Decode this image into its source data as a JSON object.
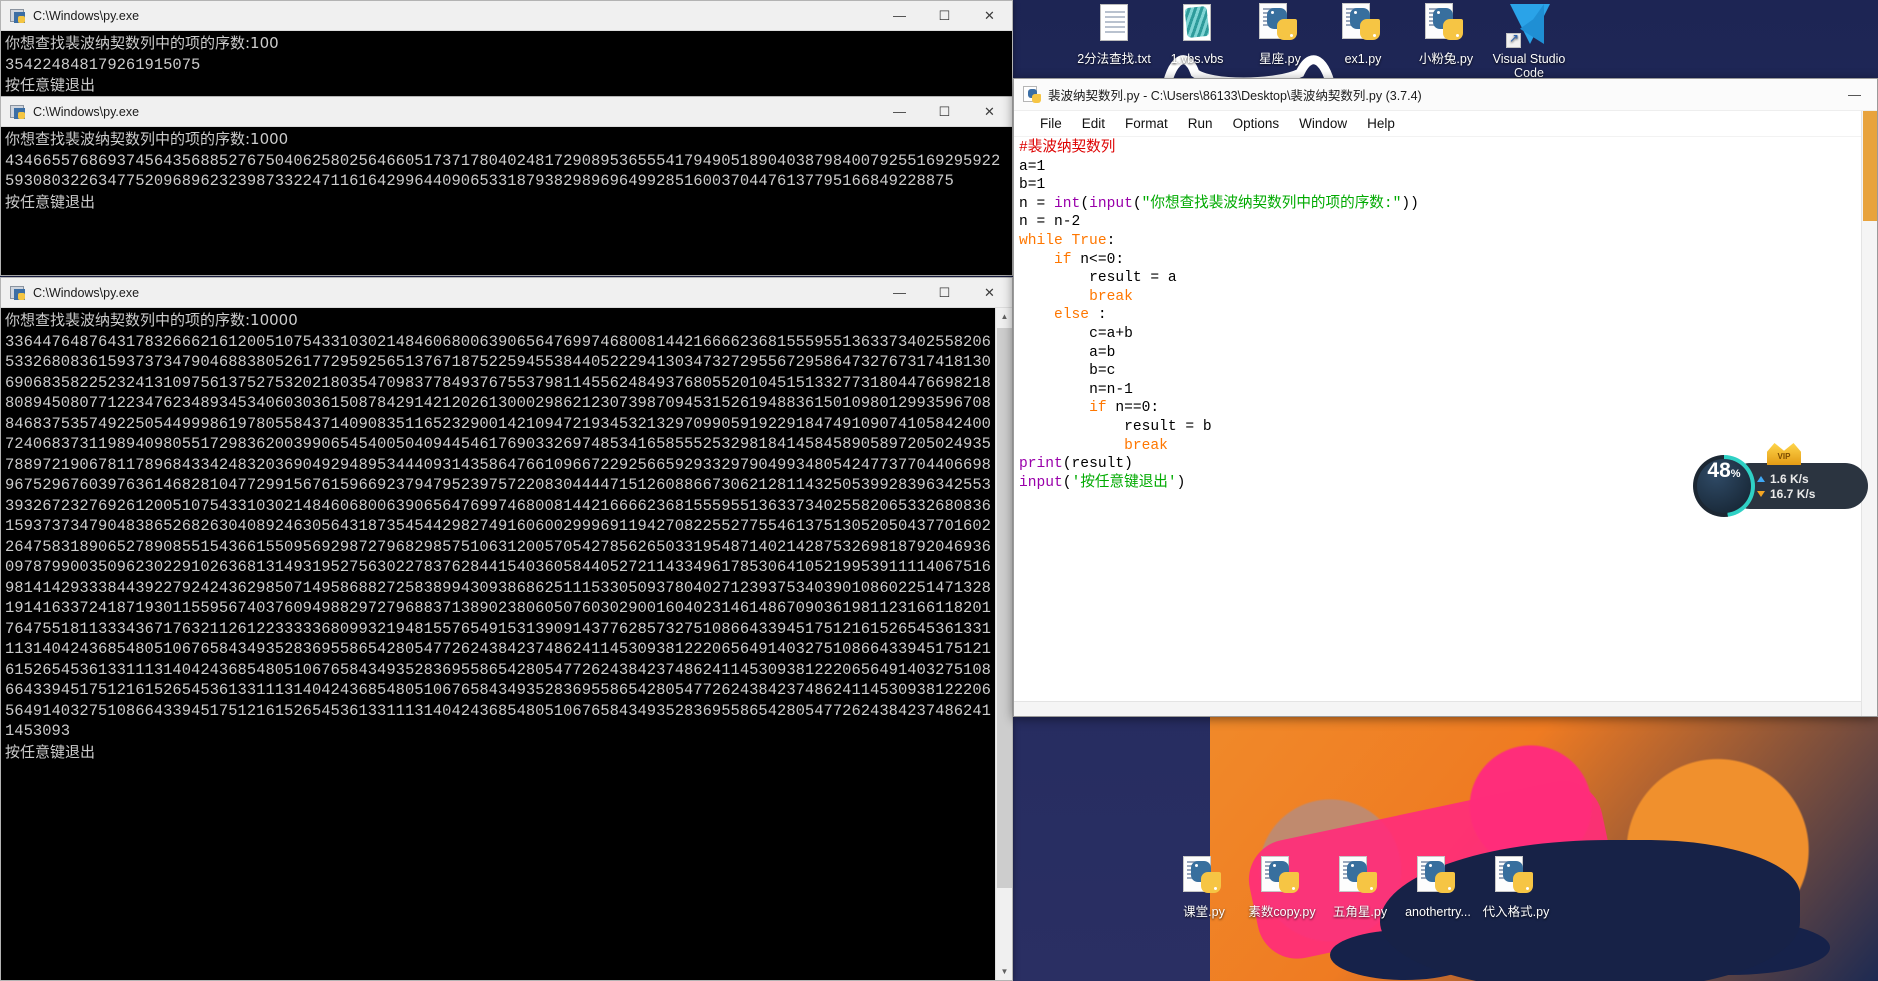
{
  "desktop": {
    "icons_top": [
      {
        "label": "2分法查找.txt",
        "type": "txt-icon",
        "icon_name": "text-file-icon"
      },
      {
        "label": "1.vbs.vbs",
        "type": "vbs-icon",
        "icon_name": "vbscript-file-icon"
      },
      {
        "label": "星座.py",
        "type": "py-icon",
        "icon_name": "python-file-icon"
      },
      {
        "label": "ex1.py",
        "type": "py-icon",
        "icon_name": "python-file-icon"
      },
      {
        "label": "小粉兔.py",
        "type": "py-icon",
        "icon_name": "python-file-icon"
      },
      {
        "label": "Visual Studio Code",
        "type": "vsc-icon",
        "icon_name": "visual-studio-code-icon"
      }
    ],
    "icons_bottom": [
      {
        "label": "课堂.py",
        "type": "py-icon",
        "icon_name": "python-file-icon"
      },
      {
        "label": "素数copy.py",
        "type": "py-icon",
        "icon_name": "python-file-icon"
      },
      {
        "label": "五角星.py",
        "type": "py-icon",
        "icon_name": "python-file-icon"
      },
      {
        "label": "anothertry...",
        "type": "py-icon",
        "icon_name": "python-file-icon"
      },
      {
        "label": "代入格式.py",
        "type": "py-icon",
        "icon_name": "python-file-icon"
      }
    ]
  },
  "consoles": [
    {
      "title": "C:\\Windows\\py.exe",
      "minimize": "—",
      "maximize": "☐",
      "close": "✕",
      "prompt": "你想查找裴波纳契数列中的项的序数:100",
      "result": "354224848179261915075",
      "exit_text": "按任意键退出"
    },
    {
      "title": "C:\\Windows\\py.exe",
      "minimize": "—",
      "maximize": "☐",
      "close": "✕",
      "prompt": "你想查找裴波纳契数列中的项的序数:1000",
      "result": "43466557686937456435688527675040625802564660517371780402481729089536555417949051890403879840079255169295922593080322634775209689623239873322471161642996440906533187938298969649928516003704476137795166849228875",
      "exit_text": "按任意键退出"
    },
    {
      "title": "C:\\Windows\\py.exe",
      "minimize": "—",
      "maximize": "☐",
      "close": "✕",
      "prompt": "你想查找裴波纳契数列中的项的序数:10000",
      "result": "33644764876431783266621612005107543310302148460680063906564769974680081442166662368155595513633734025582065332680836159373734790468838052617729592565137671875225945538440522294130347327295567295864732767317418130690683582252324131097561375275320218035470983778493767553798114556248493768055201045151332773180447669821880894508077122347623489345340603036150878429142120261300029862123073987094531526194883615010980129935967088468375357492250544999861978055843714090835116523290014210947219345321329709905919229184749109074105842400724068373119894098055172983620039906545400504094454617690332697485341658555253298184145845890589720502493578897219067811789684334248320369049294895344409314358647661096672292566592933297904993480542477377044066989675296760397636146828104772991567615966923794795239757220830444471512608866730621281143250539928396342553393267232769261200510754331030214846068006390656476997468008144216666236815559551363373402558206533268083615937373479048386526826304089246305643187354544298274916060029996911942708225527755461375130520504377016022647583189065278908551543661550956929872796829857510631200570542785626503319548714021428753269818792046936097879900350962302291026368131493195275630227837628441540360584405272114334961785306410521995391111406751698141429333844392279242436298507149586882725838994309386862511153305093780402712393753403901086022514713281914163372418719301155956740376094988297279688371389023806050760302900160402314614867090361981123166118201764755181133343671763211261223333368099321948155765491531390914377628573275108664339451751216152654536133111314042436854805106765843493528369558654280547726243842374862411453093812220656491403275108664339451751216152654536133111314042436854805106765843493528369558654280547726243842374862411453093812220656491403275108664339451751216152654536133111314042436854805106765843493528369558654280547726243842374862411453093812220656491403275108664339451751216152654536133111314042436854805106765843493528369558654280547726243842374862411453093",
      "exit_text": "按任意键退出"
    }
  ],
  "idle": {
    "title": "裴波纳契数列.py - C:\\Users\\86133\\Desktop\\裴波纳契数列.py (3.7.4)",
    "minimize": "—",
    "menu": [
      "File",
      "Edit",
      "Format",
      "Run",
      "Options",
      "Window",
      "Help"
    ],
    "code_lines": [
      {
        "indent": 0,
        "parts": [
          {
            "t": "#裴波纳契数列",
            "c": "cm"
          }
        ]
      },
      {
        "indent": 0,
        "parts": [
          {
            "t": "a=1",
            "c": ""
          }
        ]
      },
      {
        "indent": 0,
        "parts": [
          {
            "t": "b=1",
            "c": ""
          }
        ]
      },
      {
        "indent": 0,
        "parts": [
          {
            "t": "n = ",
            "c": ""
          },
          {
            "t": "int",
            "c": "bi"
          },
          {
            "t": "(",
            "c": ""
          },
          {
            "t": "input",
            "c": "bi"
          },
          {
            "t": "(",
            "c": ""
          },
          {
            "t": "\"你想查找裴波纳契数列中的项的序数:\"",
            "c": "st"
          },
          {
            "t": "))",
            "c": ""
          }
        ]
      },
      {
        "indent": 0,
        "parts": [
          {
            "t": "n = n-2",
            "c": ""
          }
        ]
      },
      {
        "indent": 0,
        "parts": [
          {
            "t": "while ",
            "c": "kw"
          },
          {
            "t": "True",
            "c": "kw"
          },
          {
            "t": ":",
            "c": ""
          }
        ]
      },
      {
        "indent": 1,
        "parts": [
          {
            "t": "if",
            "c": "kw"
          },
          {
            "t": " n<=0:",
            "c": ""
          }
        ]
      },
      {
        "indent": 2,
        "parts": [
          {
            "t": "result = a",
            "c": ""
          }
        ]
      },
      {
        "indent": 2,
        "parts": [
          {
            "t": "break",
            "c": "kw"
          }
        ]
      },
      {
        "indent": 1,
        "parts": [
          {
            "t": "else",
            "c": "kw"
          },
          {
            "t": " :",
            "c": ""
          }
        ]
      },
      {
        "indent": 2,
        "parts": [
          {
            "t": "c=a+b",
            "c": ""
          }
        ]
      },
      {
        "indent": 2,
        "parts": [
          {
            "t": "a=b",
            "c": ""
          }
        ]
      },
      {
        "indent": 2,
        "parts": [
          {
            "t": "b=c",
            "c": ""
          }
        ]
      },
      {
        "indent": 2,
        "parts": [
          {
            "t": "n=n-1",
            "c": ""
          }
        ]
      },
      {
        "indent": 2,
        "parts": [
          {
            "t": "if",
            "c": "kw"
          },
          {
            "t": " n==0:",
            "c": ""
          }
        ]
      },
      {
        "indent": 3,
        "parts": [
          {
            "t": "result = b",
            "c": ""
          }
        ]
      },
      {
        "indent": 3,
        "parts": [
          {
            "t": "break",
            "c": "kw"
          }
        ]
      },
      {
        "indent": 0,
        "parts": [
          {
            "t": "print",
            "c": "bi"
          },
          {
            "t": "(result)",
            "c": ""
          }
        ]
      },
      {
        "indent": 0,
        "parts": [
          {
            "t": "input",
            "c": "bi"
          },
          {
            "t": "(",
            "c": ""
          },
          {
            "t": "'按任意键退出'",
            "c": "st"
          },
          {
            "t": ")",
            "c": ""
          }
        ]
      }
    ]
  },
  "netwidget": {
    "percent": "48",
    "percent_symbol": "%",
    "upload": "1.6 K/s",
    "download": "16.7 K/s",
    "badge": "VIP"
  },
  "colors": {
    "accent_orange": "#ff7700",
    "string_green": "#00aa00",
    "comment_red": "#dd0000",
    "builtin_purple": "#9900aa",
    "desktop_blue": "#1d2554",
    "net_teal": "#2fd1c5"
  }
}
